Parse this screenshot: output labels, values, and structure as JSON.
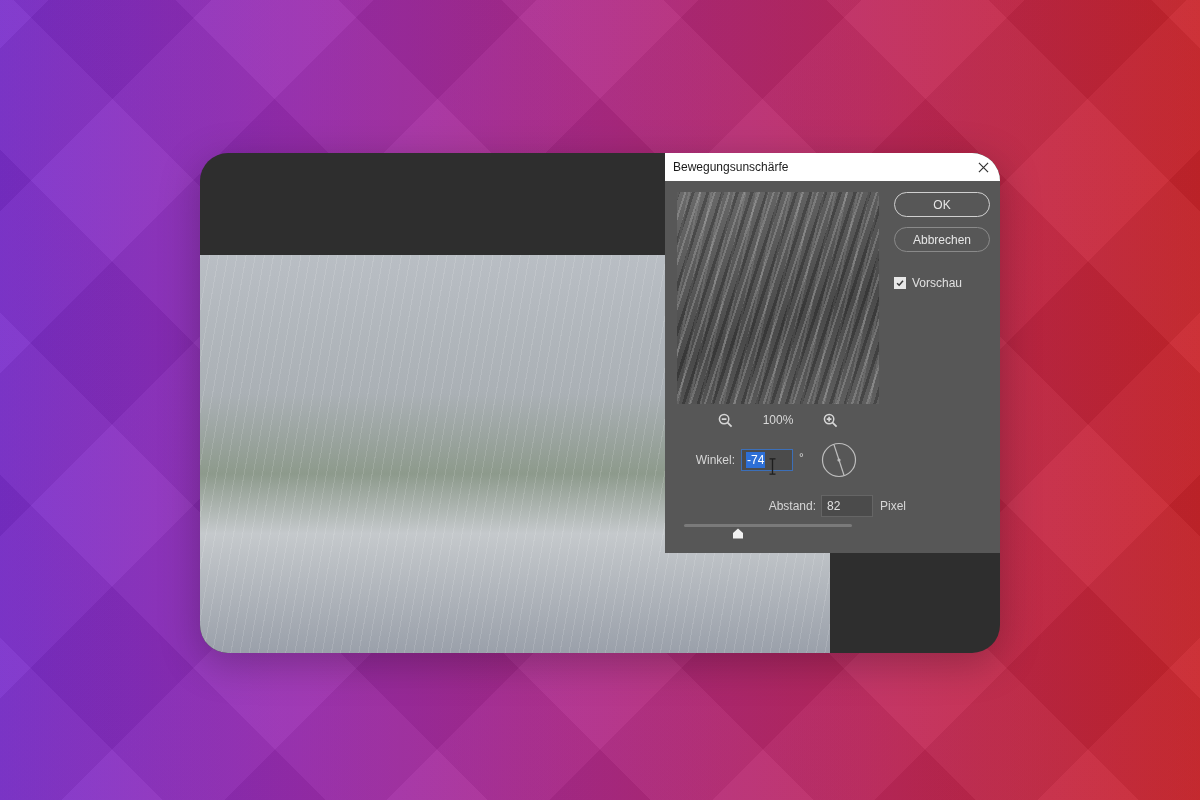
{
  "dialog": {
    "title": "Bewegungsunschärfe",
    "buttons": [
      {
        "label": "OK",
        "kind": "primary"
      },
      {
        "label": "Abbrechen",
        "kind": "secondary"
      }
    ],
    "preview_checkbox": {
      "label": "Vorschau",
      "checked": true
    },
    "zoom": {
      "value": "100%"
    },
    "angle": {
      "label": "Winkel:",
      "value": "-74",
      "unit": "°",
      "highlighted": true
    },
    "distance": {
      "label": "Abstand:",
      "value": "82",
      "unit": "Pixel"
    },
    "slider": {
      "level": 0.32
    }
  }
}
